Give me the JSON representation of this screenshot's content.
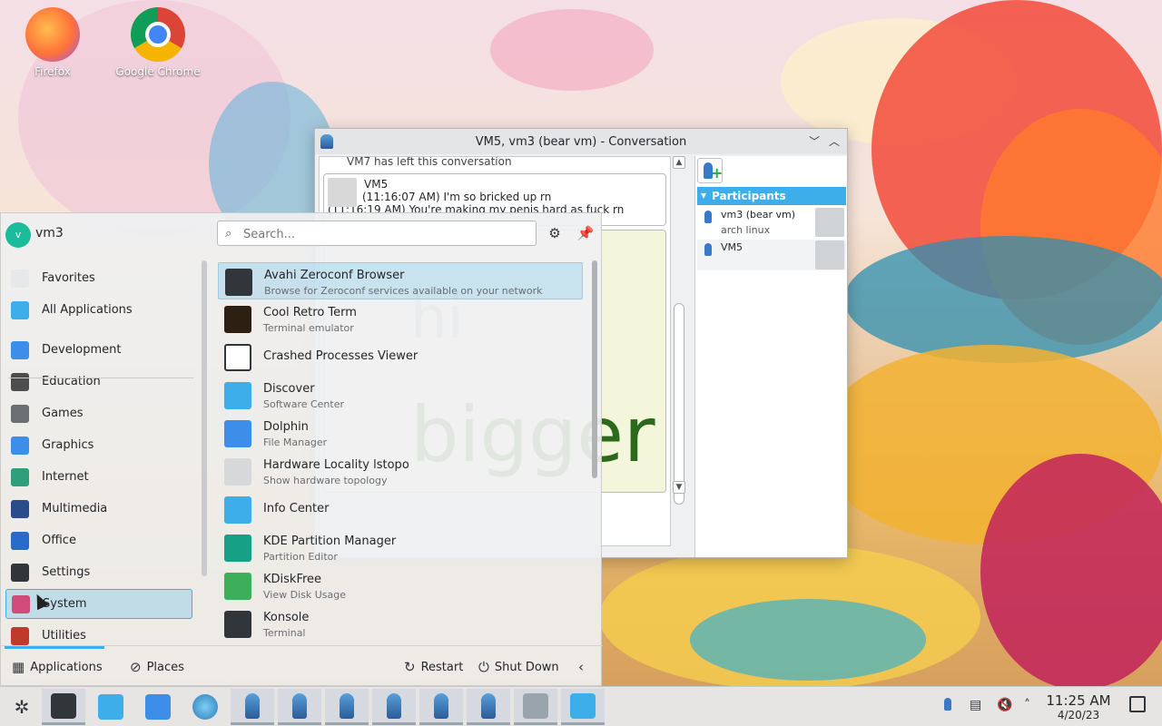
{
  "desktop": {
    "icons": [
      {
        "label": "Firefox",
        "icon": "firefox-icon"
      },
      {
        "label": "Google Chrome",
        "icon": "chrome-icon"
      }
    ]
  },
  "conversation": {
    "title": "VM5, vm3 (bear vm) - Conversation",
    "status_line": "VM7 has left this conversation",
    "messages": [
      {
        "sender": "VM5",
        "lines": [
          "(11:16:07 AM) I'm so bricked up rn",
          "(11:16:19 AM) You're making my penis hard as fuck rn"
        ]
      }
    ],
    "big_message": {
      "line1": "hi",
      "line2": "bigger"
    },
    "participants_label": "Participants",
    "participants": [
      {
        "name": "vm3 (bear vm)",
        "status": "arch linux"
      },
      {
        "name": "VM5",
        "status": ""
      }
    ]
  },
  "menu": {
    "user": {
      "initial": "v",
      "name": "vm3"
    },
    "search": {
      "placeholder": "Search..."
    },
    "categories": [
      {
        "label": "Favorites",
        "icon": "bookmark-icon",
        "color": "#e7e8e9"
      },
      {
        "label": "All Applications",
        "icon": "grid-icon",
        "color": "#3daee9"
      },
      {
        "label": "Development",
        "icon": "development-icon",
        "color": "#3d8ee9"
      },
      {
        "label": "Education",
        "icon": "education-icon",
        "color": "#4d4d4d"
      },
      {
        "label": "Games",
        "icon": "gamepad-icon",
        "color": "#6b6e72"
      },
      {
        "label": "Graphics",
        "icon": "graphics-icon",
        "color": "#3d8ee9"
      },
      {
        "label": "Internet",
        "icon": "globe-icon",
        "color": "#2f9e7a"
      },
      {
        "label": "Multimedia",
        "icon": "multimedia-icon",
        "color": "#2a4c8a"
      },
      {
        "label": "Office",
        "icon": "office-icon",
        "color": "#2a6ac8"
      },
      {
        "label": "Settings",
        "icon": "settings-icon",
        "color": "#31363b"
      },
      {
        "label": "System",
        "icon": "system-icon",
        "color": "#d04a7a"
      },
      {
        "label": "Utilities",
        "icon": "utilities-icon",
        "color": "#c0392b"
      }
    ],
    "apps": [
      {
        "name": "Avahi Zeroconf Browser",
        "desc": "Browse for Zeroconf services available on your network",
        "icon": "network-icon",
        "color": "#31363b"
      },
      {
        "name": "Cool Retro Term",
        "desc": "Terminal emulator",
        "icon": "crt-icon",
        "color": "#2d1f12"
      },
      {
        "name": "Crashed Processes Viewer",
        "desc": "",
        "icon": "crash-icon",
        "color": "#ffffff"
      },
      {
        "name": "Discover",
        "desc": "Software Center",
        "icon": "discover-icon",
        "color": "#3daee9"
      },
      {
        "name": "Dolphin",
        "desc": "File Manager",
        "icon": "folder-icon",
        "color": "#3d8ee9"
      },
      {
        "name": "Hardware Locality lstopo",
        "desc": "Show hardware topology",
        "icon": "hardware-icon",
        "color": "#d7d8d9"
      },
      {
        "name": "Info Center",
        "desc": "",
        "icon": "info-icon",
        "color": "#3daee9"
      },
      {
        "name": "KDE Partition Manager",
        "desc": "Partition Editor",
        "icon": "partition-icon",
        "color": "#16a085"
      },
      {
        "name": "KDiskFree",
        "desc": "View Disk Usage",
        "icon": "disk-icon",
        "color": "#3dae5a"
      },
      {
        "name": "Konsole",
        "desc": "Terminal",
        "icon": "terminal-icon",
        "color": "#31363b"
      }
    ],
    "footer": {
      "applications": "Applications",
      "places": "Places",
      "restart": "Restart",
      "shutdown": "Shut Down"
    }
  },
  "taskbar": {
    "time": "11:25 AM",
    "date": "4/20/23"
  }
}
